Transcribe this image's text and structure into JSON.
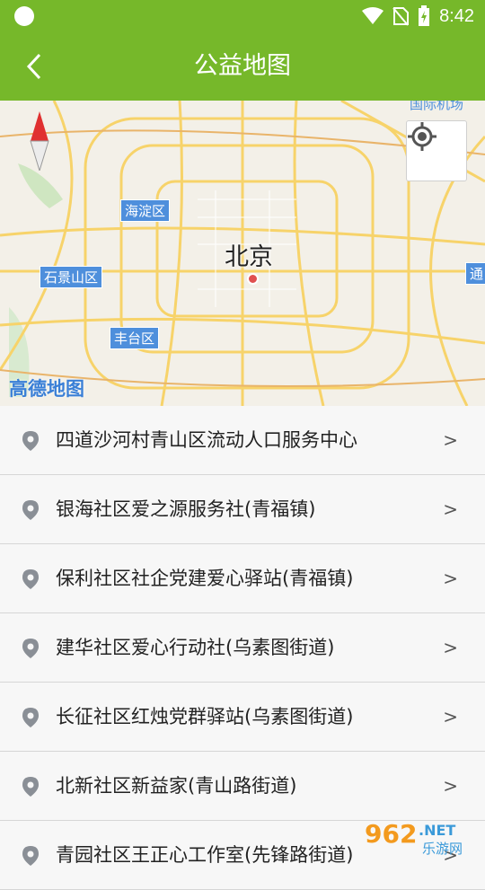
{
  "status_bar": {
    "time": "8:42"
  },
  "app_bar": {
    "title": "公益地图",
    "back_icon": "back-arrow-icon"
  },
  "map": {
    "city": "北京",
    "districts": [
      "海淀区",
      "石景山区",
      "丰台区"
    ],
    "logo": "高德地图",
    "edge_labels": [
      "国际机场",
      "通"
    ],
    "locate_icon": "locate-target-icon",
    "compass_icon": "compass-icon"
  },
  "list": {
    "arrow": ">",
    "items": [
      "四道沙河村青山区流动人口服务中心",
      "银海社区爱之源服务社(青福镇)",
      "保利社区社企党建爱心驿站(青福镇)",
      "建华社区爱心行动社(乌素图街道)",
      "长征社区红烛党群驿站(乌素图街道)",
      "北新社区新益家(青山路街道)",
      "青园社区王正心工作室(先锋路街道)"
    ]
  },
  "watermark": {
    "text": "962",
    "net": ".NET",
    "sub": "乐游网"
  }
}
